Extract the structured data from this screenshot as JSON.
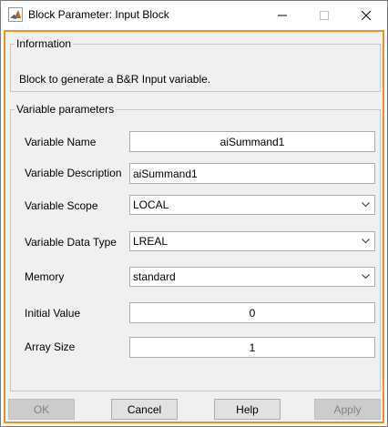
{
  "window": {
    "title": "Block Parameter: Input Block"
  },
  "information": {
    "legend": "Information",
    "text": "Block to generate a B&R Input variable."
  },
  "parameters": {
    "legend": "Variable parameters",
    "variable_name": {
      "label": "Variable Name",
      "value": "aiSummand1"
    },
    "variable_description": {
      "label": "Variable Description",
      "value": "aiSummand1"
    },
    "variable_scope": {
      "label": "Variable Scope",
      "value": "LOCAL"
    },
    "variable_data_type": {
      "label": "Variable Data Type",
      "value": "LREAL"
    },
    "memory": {
      "label": "Memory",
      "value": "standard"
    },
    "initial_value": {
      "label": "Initial Value",
      "value": "0"
    },
    "array_size": {
      "label": "Array Size",
      "value": "1"
    }
  },
  "buttons": {
    "ok": "OK",
    "cancel": "Cancel",
    "help": "Help",
    "apply": "Apply"
  },
  "colors": {
    "focus_border": "#e69522",
    "panel_background": "#f0f0f0",
    "disabled_button": "#cccccc"
  }
}
